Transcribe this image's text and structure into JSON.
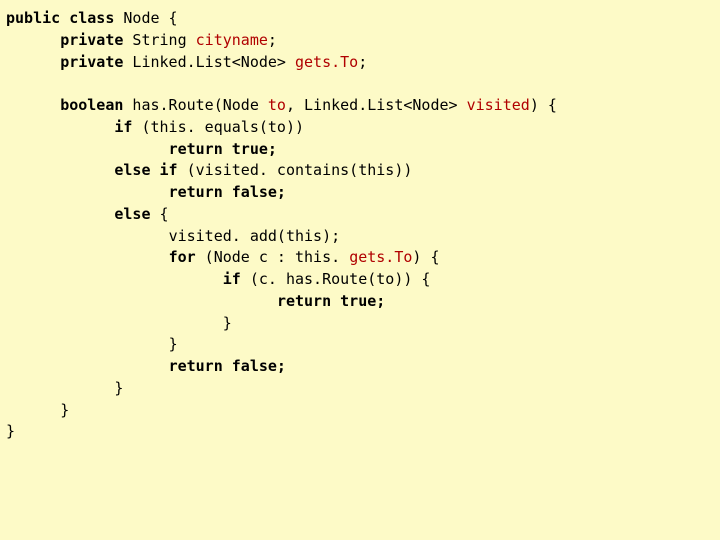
{
  "code": {
    "l1_kw1": "public class",
    "l1_txt": " Node {",
    "l2_kw1": "private",
    "l2_txt1": " String ",
    "l2_id": "cityname",
    "l2_txt2": ";",
    "l3_kw1": "private",
    "l3_txt1": " Linked.List<Node> ",
    "l3_id": "gets.To",
    "l3_txt2": ";",
    "l4_kw1": "boolean",
    "l4_txt1": " has.Route(Node ",
    "l4_id1": "to",
    "l4_txt2": ", Linked.List<Node> ",
    "l4_id2": "visited",
    "l4_txt3": ") {",
    "l5_kw1": "if",
    "l5_txt1": " (this. equals(to))",
    "l6_kw1": "return true;",
    "l7_kw1": "else if",
    "l7_txt1": " (visited. contains(this))",
    "l8_kw1": "return false;",
    "l9_kw1": "else",
    "l9_txt1": " {",
    "l10_txt1": "visited. add(this);",
    "l11_kw1": "for",
    "l11_txt1": " (Node c : this. ",
    "l11_id": "gets.To",
    "l11_txt2": ") {",
    "l12_kw1": "if",
    "l12_txt1": " (c. has.Route(to)) {",
    "l13_kw1": "return true;",
    "l14_txt1": "}",
    "l15_txt1": "}",
    "l16_kw1": "return false;",
    "l17_txt1": "}",
    "l18_txt1": "}",
    "l19_txt1": "}"
  }
}
